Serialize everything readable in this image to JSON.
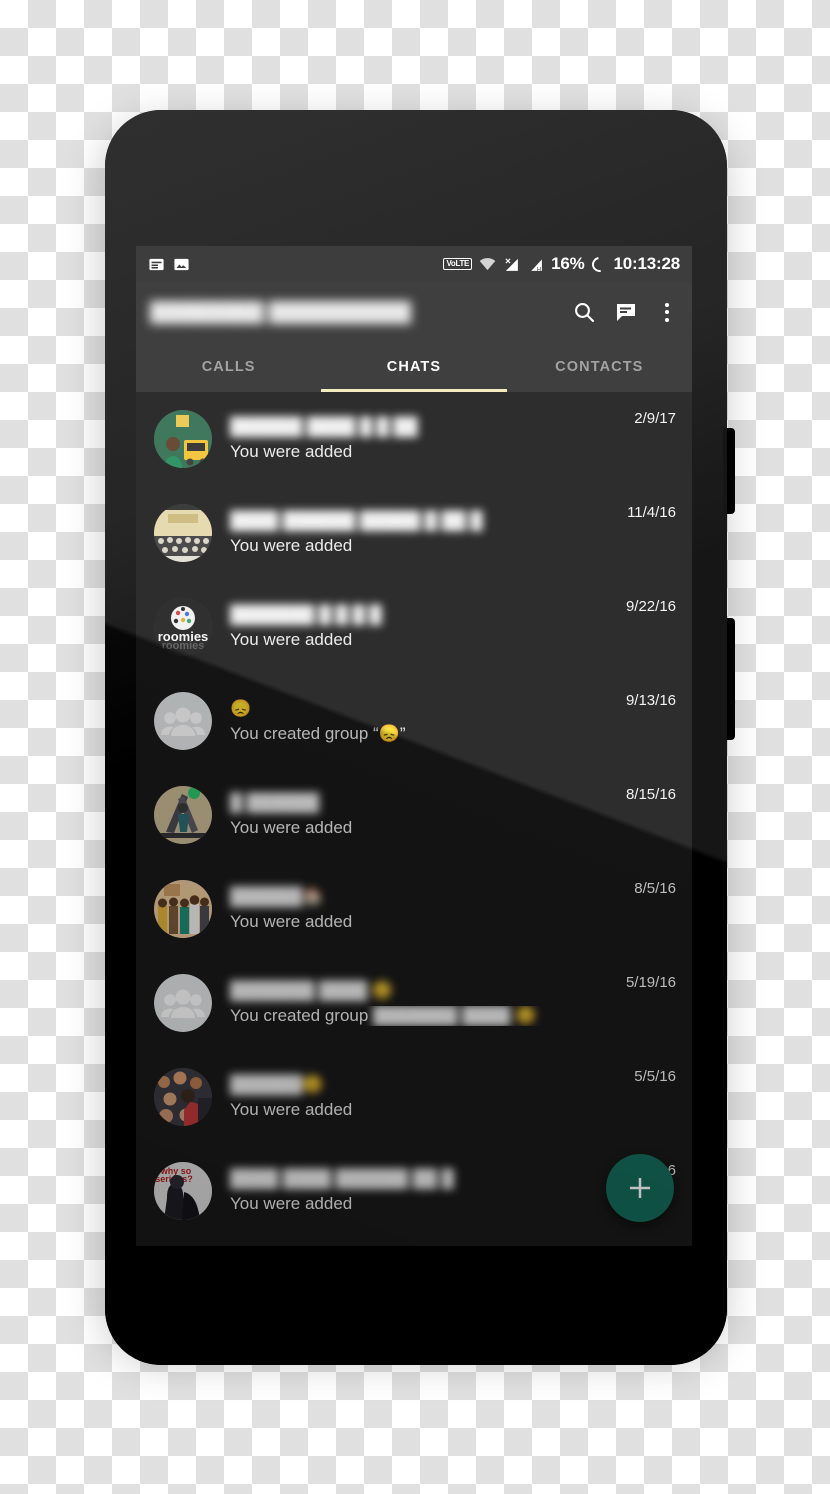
{
  "status_bar": {
    "notification_icons": [
      "note-icon",
      "image-icon"
    ],
    "volte_label": "VoLTE",
    "wifi_icon": "wifi-icon",
    "sim1_icon": "signal-no-service-icon",
    "sim2_icon": "signal-hspa-icon",
    "battery_percent": "16%",
    "battery_icon": "battery-ring-icon",
    "time": "10:13:28"
  },
  "app_bar": {
    "title": "████████ ██████████",
    "search_label": "search-icon",
    "new_message_label": "new-message-icon",
    "overflow_label": "overflow-menu-icon"
  },
  "tabs": {
    "items": [
      {
        "label": "CALLS",
        "active": false
      },
      {
        "label": "CHATS",
        "active": true
      },
      {
        "label": "CONTACTS",
        "active": false
      }
    ],
    "indicator_color": "#f2eab8"
  },
  "chats": [
    {
      "name": "██████ ████ █ █ ██",
      "preview": "You were added",
      "preview_suffix": "",
      "date": "2/9/17",
      "avatar": "photo-green-auto",
      "name_blurred": true
    },
    {
      "name": "████ ██████ █████ █ ██ █",
      "preview": "You were added",
      "preview_suffix": "",
      "date": "11/4/16",
      "avatar": "photo-group-hall",
      "name_blurred": true
    },
    {
      "name": "███████ █ █ █ █",
      "preview": "You were added",
      "preview_suffix": "",
      "date": "9/22/16",
      "avatar": "roomies-logo",
      "name_blurred": true
    },
    {
      "name": "😞",
      "preview": "You created group “😞”",
      "preview_suffix": "",
      "date": "9/13/16",
      "avatar": "default-group-icon",
      "name_blurred": false
    },
    {
      "name": "█ ██████",
      "preview": "You were added",
      "preview_suffix": "",
      "date": "8/15/16",
      "avatar": "photo-gym",
      "name_blurred": true
    },
    {
      "name": "██████🏠",
      "preview": "You were added",
      "preview_suffix": "",
      "date": "8/5/16",
      "avatar": "photo-family",
      "name_blurred": true
    },
    {
      "name": "███████ ████ 😊",
      "preview": "You created group",
      "preview_suffix": "███████ ████ 😊",
      "date": "5/19/16",
      "avatar": "default-group-icon",
      "name_blurred": true
    },
    {
      "name": "██████😊",
      "preview": "You were added",
      "preview_suffix": "",
      "date": "5/5/16",
      "avatar": "photo-selfie",
      "name_blurred": true
    },
    {
      "name": "████ ████ ██████ ██ █",
      "preview": "You were added",
      "preview_suffix": "",
      "date": "5/5/16",
      "avatar": "photo-joker",
      "name_blurred": true
    }
  ],
  "fab": {
    "label": "new-chat-fab",
    "icon": "plus-icon",
    "color": "#146b5b"
  },
  "colors": {
    "screen_bg": "#191919",
    "appbar_bg": "#2d2d2d",
    "statusbar_bg": "#2b2b2b",
    "accent": "#f2eab8",
    "fab": "#146b5b"
  }
}
